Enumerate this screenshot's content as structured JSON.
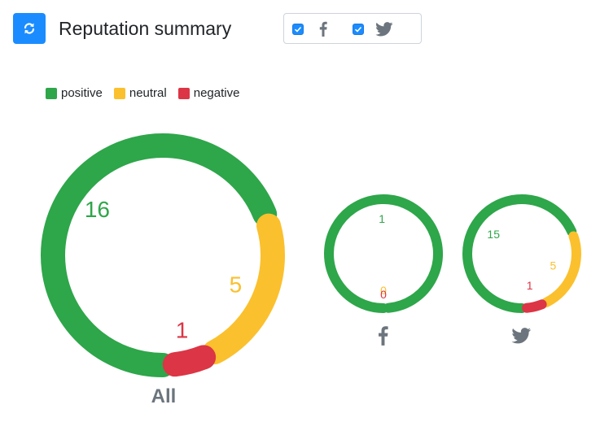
{
  "header": {
    "title": "Reputation summary",
    "refresh_icon": "refresh-icon"
  },
  "filters": {
    "facebook": {
      "checked": true,
      "icon": "facebook-icon"
    },
    "twitter": {
      "checked": true,
      "icon": "twitter-icon"
    }
  },
  "colors": {
    "positive": "#2ea64a",
    "neutral": "#fbc02d",
    "negative": "#dc3545",
    "accent": "#1a8cff",
    "muted": "#6c757d"
  },
  "chart_data": [
    {
      "type": "donut",
      "name": "all",
      "label": "All",
      "legend": [
        "positive",
        "neutral",
        "negative"
      ],
      "legend_position": "top-left",
      "series": [
        {
          "name": "positive",
          "value": 16
        },
        {
          "name": "neutral",
          "value": 5
        },
        {
          "name": "negative",
          "value": 1
        }
      ]
    },
    {
      "type": "donut",
      "name": "facebook",
      "icon": "facebook-icon",
      "series": [
        {
          "name": "positive",
          "value": 1
        },
        {
          "name": "neutral",
          "value": 0
        },
        {
          "name": "negative",
          "value": 0
        }
      ]
    },
    {
      "type": "donut",
      "name": "twitter",
      "icon": "twitter-icon",
      "series": [
        {
          "name": "positive",
          "value": 15
        },
        {
          "name": "neutral",
          "value": 5
        },
        {
          "name": "negative",
          "value": 1
        }
      ]
    }
  ]
}
